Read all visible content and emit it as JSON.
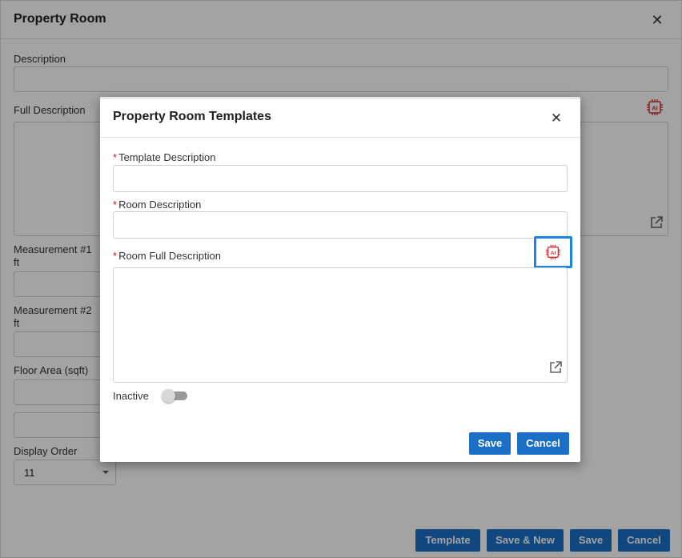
{
  "background_dialog": {
    "title": "Property Room",
    "fields": {
      "description_label": "Description",
      "full_description_label": "Full Description",
      "measurement1_label": "Measurement #1",
      "measurement1_unit": "ft",
      "measurement2_label": "Measurement #2",
      "measurement2_unit": "ft",
      "floor_area_label": "Floor Area (sqft)",
      "display_order_label": "Display Order",
      "display_order_value": "11"
    },
    "buttons": {
      "template": "Template",
      "save_new": "Save & New",
      "save": "Save",
      "cancel": "Cancel"
    }
  },
  "modal": {
    "title": "Property Room Templates",
    "required_marker": "*",
    "template_description_label": "Template Description",
    "template_description_value": "",
    "room_description_label": "Room Description",
    "room_description_value": "",
    "room_full_description_label": "Room Full Description",
    "inactive_label": "Inactive",
    "inactive_value": false,
    "buttons": {
      "save": "Save",
      "cancel": "Cancel"
    }
  },
  "icons": {
    "close": "close-icon",
    "ai": "ai-chip-icon",
    "external_link": "external-link-icon"
  },
  "colors": {
    "primary_button": "#1b6fc7",
    "ai_icon": "#d32f2f",
    "ai_highlight_border": "#1b85e3",
    "required": "#dd1111"
  }
}
